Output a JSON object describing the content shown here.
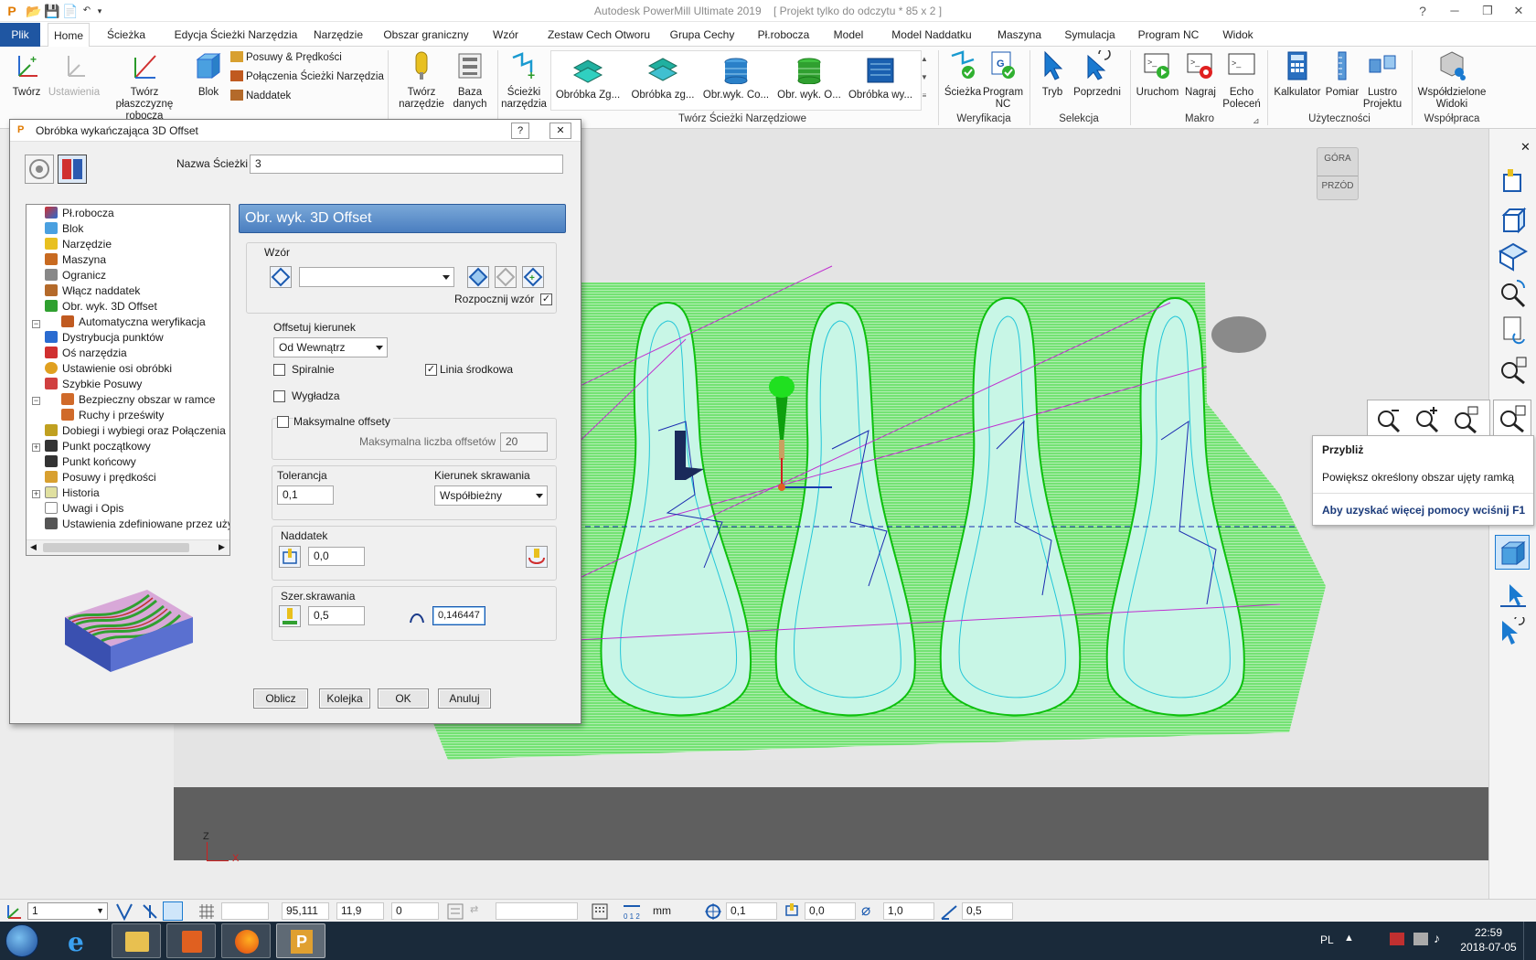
{
  "window": {
    "title": "Autodesk PowerMill Ultimate 2019",
    "project": "[ Projekt tylko do odczytu * 85 x 2 ]",
    "help": "?",
    "minimize": "─",
    "restore": "❐",
    "close": "✕"
  },
  "tabs": [
    {
      "label": "Plik"
    },
    {
      "label": "Home"
    },
    {
      "label": "Ścieżka"
    },
    {
      "label": "Edycja Ścieżki Narzędzia"
    },
    {
      "label": "Narzędzie"
    },
    {
      "label": "Obszar graniczny"
    },
    {
      "label": "Wzór"
    },
    {
      "label": "Zestaw Cech Otworu"
    },
    {
      "label": "Grupa Cechy"
    },
    {
      "label": "Pł.robocza"
    },
    {
      "label": "Model"
    },
    {
      "label": "Model Naddatku"
    },
    {
      "label": "Maszyna"
    },
    {
      "label": "Symulacja"
    },
    {
      "label": "Program NC"
    },
    {
      "label": "Widok"
    }
  ],
  "ribbon": {
    "tworz": "Twórz",
    "ustawienia": "Ustawienia",
    "tworz_plaszczyzne_1": "Twórz płaszczyznę",
    "tworz_plaszczyzne_2": "roboczą",
    "blok": "Blok",
    "posuwy": "Posuwy & Prędkości",
    "polaczenia": "Połączenia Ścieżki Narzędzia",
    "naddatek": "Naddatek",
    "tworz_narzedzie_1": "Twórz",
    "tworz_narzedzie_2": "narzędzie",
    "baza_1": "Baza",
    "baza_2": "danych",
    "sciezki_1": "Ścieżki",
    "sciezki_2": "narzędzia",
    "gallery": [
      "Obróbka Zg...",
      "Obróbka zg...",
      "Obr.wyk. Co...",
      "Obr. wyk. O...",
      "Obróbka wy..."
    ],
    "group_tworz_sciezki": "Twórz Ścieżki Narzędziowe",
    "sciezka": "Ścieżka",
    "program_nc_1": "Program",
    "program_nc_2": "NC",
    "group_weryfikacja": "Weryfikacja",
    "tryb": "Tryb",
    "poprzedni": "Poprzedni",
    "group_selekcja": "Selekcja",
    "uruchom": "Uruchom",
    "nagraj": "Nagraj",
    "echo_1": "Echo",
    "echo_2": "Poleceń",
    "group_makro": "Makro",
    "kalkulator": "Kalkulator",
    "pomiar": "Pomiar",
    "lustro_1": "Lustro",
    "lustro_2": "Projektu",
    "group_uzytecznosci": "Użyteczności",
    "wspoldzielone_1": "Współdzielone",
    "wspoldzielone_2": "Widoki",
    "group_wspolpraca": "Współpraca"
  },
  "dialog": {
    "title": "Obróbka wykańczająca 3D Offset",
    "help": "?",
    "close": "✕",
    "path_name_label": "Nazwa Ścieżki",
    "path_name_value": "3",
    "section_header": "Obr. wyk. 3D Offset",
    "tree": [
      {
        "label": "Pł.robocza"
      },
      {
        "label": "Blok"
      },
      {
        "label": "Narzędzie"
      },
      {
        "label": "Maszyna"
      },
      {
        "label": "Ogranicz"
      },
      {
        "label": "Włącz naddatek"
      },
      {
        "label": "Obr. wyk. 3D Offset"
      },
      {
        "label": "Automatyczna weryfikacja"
      },
      {
        "label": "Dystrybucja punktów"
      },
      {
        "label": "Oś narzędzia"
      },
      {
        "label": "Ustawienie osi obróbki"
      },
      {
        "label": "Szybkie Posuwy"
      },
      {
        "label": "Bezpieczny obszar w ramce"
      },
      {
        "label": "Ruchy i prześwity"
      },
      {
        "label": "Dobiegi i wybiegi oraz Połączenia"
      },
      {
        "label": "Punkt początkowy"
      },
      {
        "label": "Punkt końcowy"
      },
      {
        "label": "Posuwy i prędkości"
      },
      {
        "label": "Historia"
      },
      {
        "label": "Uwagi i Opis"
      },
      {
        "label": "Ustawienia zdefiniowane przez użytkownika"
      }
    ],
    "wzor_label": "Wzór",
    "wzor_value": "",
    "rozpocznij_wzor": "Rozpocznij wzór",
    "rozpocznij_wzor_checked": true,
    "offsetuj_label": "Offsetuj kierunek",
    "offsetuj_value": "Od Wewnątrz",
    "spiralnie": "Spiralnie",
    "spiralnie_checked": false,
    "linia_srodkowa": "Linia środkowa",
    "linia_srodkowa_checked": true,
    "wygladza": "Wygładza",
    "wygladza_checked": false,
    "maksymalne_offsety": "Maksymalne offsety",
    "maksymalne_offsety_checked": false,
    "max_offsets_label": "Maksymalna liczba offsetów",
    "max_offsets_value": "20",
    "tolerancja_label": "Tolerancja",
    "tolerancja_value": "0,1",
    "kierunek_label": "Kierunek skrawania",
    "kierunek_value": "Współbieżny",
    "naddatek_label": "Naddatek",
    "naddatek_value": "0,0",
    "szer_label": "Szer.skrawania",
    "szer_value": "0,5",
    "scallop_value": "0,146447",
    "buttons": {
      "oblicz": "Oblicz",
      "kolejka": "Kolejka",
      "ok": "OK",
      "anuluj": "Anuluj"
    }
  },
  "viewcube": {
    "gora": "GÓRA",
    "przod": "PRZÓD"
  },
  "axes": {
    "z": "Z",
    "x": "X"
  },
  "tooltip": {
    "title": "Przybliż",
    "description": "Powiększ określony obszar ujęty ramką",
    "help": "Aby uzyskać więcej pomocy wciśnij F1"
  },
  "status": {
    "plane_value": "1",
    "coord_x": "95,111",
    "coord_y": "11,9",
    "coord_z": "0",
    "units": "mm",
    "tol": "0,1",
    "stock": "0,0",
    "diameter": "1,0",
    "stepover": "0,5"
  },
  "taskbar": {
    "lang": "PL",
    "time": "22:59",
    "date": "2018-07-05"
  },
  "colors": {
    "file_tab": "#1f56a2",
    "section_header": "#4a86c8",
    "toolpath_green": "#3ddc3d",
    "toolpath_cyan": "#2fd6e6"
  }
}
